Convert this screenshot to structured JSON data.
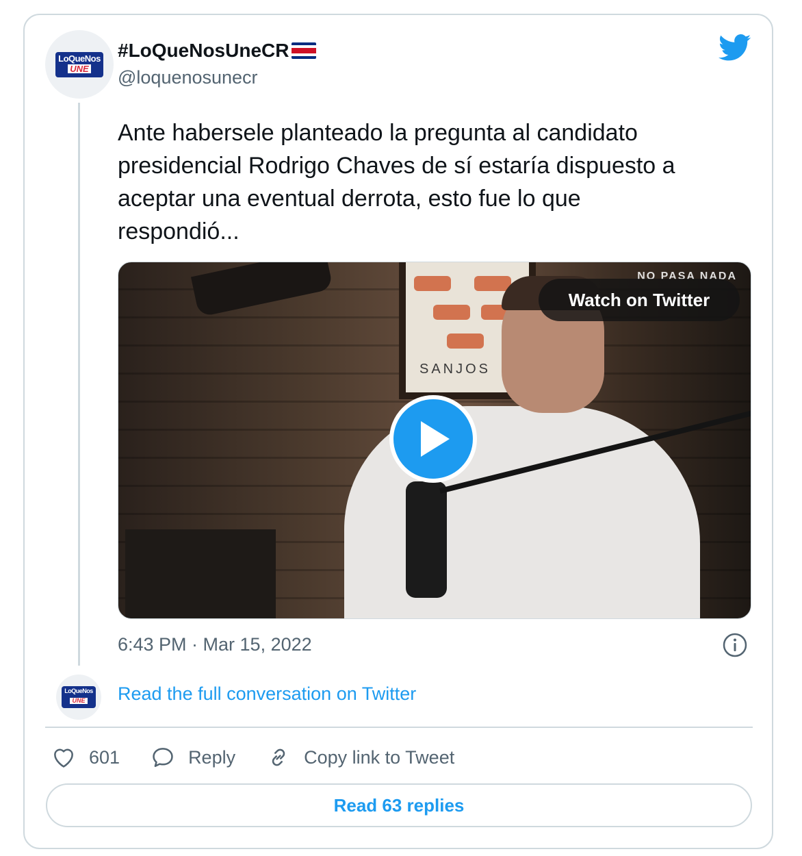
{
  "author": {
    "display_name": "#LoQueNosUneCR",
    "handle": "@loquenosunecr",
    "flag_icon": "costa-rica-flag-icon",
    "avatar_logo": {
      "line1": "LoQueNos",
      "line2": "UNE"
    }
  },
  "tweet": {
    "text": "Ante habersele planteado la pregunta al candidato\npresidencial Rodrigo Chaves de sí estaría dispuesto a\naceptar una eventual derrota, esto fue lo que\nrespondió...",
    "timestamp": "6:43 PM · Mar 15, 2022"
  },
  "media": {
    "watch_label": "Watch on Twitter",
    "watermark": "NO PASA NADA",
    "poster_text": "SANJOS"
  },
  "conversation": {
    "read_full_label": "Read the full conversation on Twitter"
  },
  "actions": {
    "likes_count": "601",
    "reply_label": "Reply",
    "copy_link_label": "Copy link to Tweet"
  },
  "footer": {
    "read_replies_label": "Read 63 replies"
  },
  "colors": {
    "twitter_blue": "#1d9bf0",
    "muted_text": "#536471",
    "border": "#cfd9de"
  }
}
